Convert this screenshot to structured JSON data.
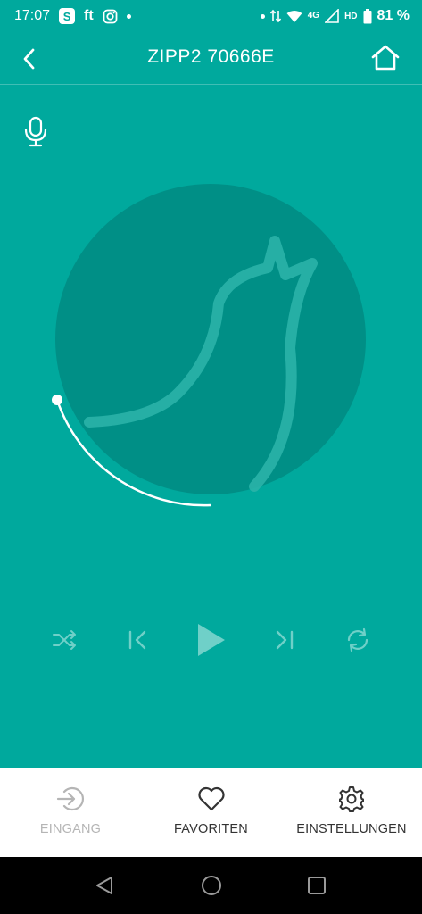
{
  "status_bar": {
    "time": "17:07",
    "app_icons": [
      "S",
      "ft",
      "instagram-icon"
    ],
    "network": "4G",
    "hd": "HD",
    "battery": "81 %"
  },
  "header": {
    "title": "ZIPP2 70666E"
  },
  "player": {
    "progress_fraction": 0.18,
    "controls": [
      "shuffle-icon",
      "previous-icon",
      "play-icon",
      "next-icon",
      "repeat-icon"
    ]
  },
  "bottom_nav": {
    "items": [
      {
        "label": "EINGANG",
        "icon": "input-icon",
        "color": "#B5B5B5"
      },
      {
        "label": "FAVORITEN",
        "icon": "heart-icon",
        "color": "#333333"
      },
      {
        "label": "EINSTELLUNGEN",
        "icon": "gear-icon",
        "color": "#333333"
      }
    ]
  },
  "colors": {
    "background": "#00A99D",
    "artwork_circle": "#008F86",
    "artwork_logo": "#2AB3A8",
    "nav_background": "#FFFFFF"
  }
}
